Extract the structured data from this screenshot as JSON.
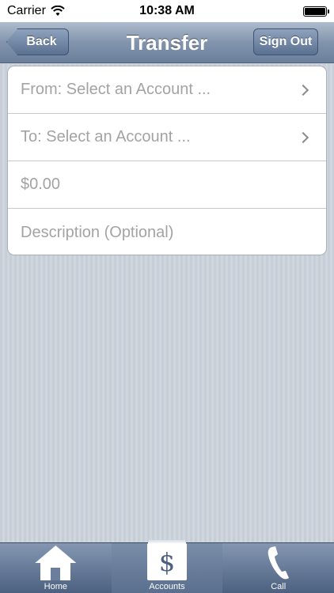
{
  "status_bar": {
    "carrier": "Carrier",
    "time": "10:38 AM"
  },
  "nav": {
    "title": "Transfer",
    "back_label": "Back",
    "signout_label": "Sign Out"
  },
  "form": {
    "from_placeholder": "From: Select an Account ...",
    "to_placeholder": "To: Select an Account ...",
    "amount_placeholder": "$0.00",
    "description_placeholder": "Description (Optional)"
  },
  "tabs": [
    {
      "label": "Home",
      "icon": "house-icon"
    },
    {
      "label": "Accounts",
      "icon": "dollar-icon",
      "selected": true
    },
    {
      "label": "Call",
      "icon": "phone-icon"
    }
  ],
  "colors": {
    "nav_bar": "#8294ad",
    "button": "#5b7191",
    "placeholder_text": "#a3a3a3"
  }
}
